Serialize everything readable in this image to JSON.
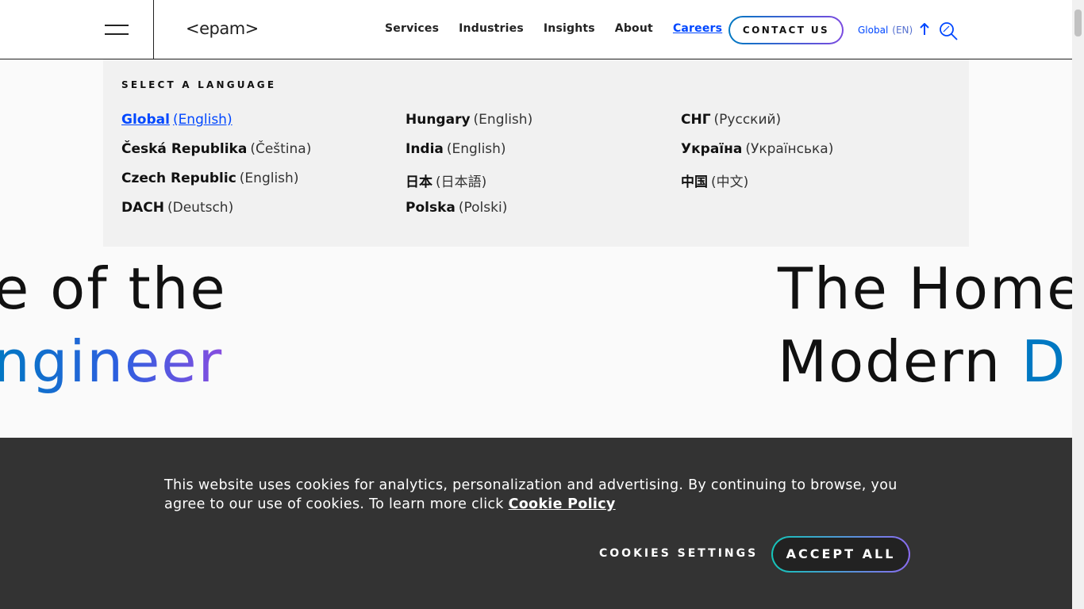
{
  "header": {
    "logo": "<epam>",
    "nav": [
      {
        "label": "Services"
      },
      {
        "label": "Industries"
      },
      {
        "label": "Insights"
      },
      {
        "label": "About"
      },
      {
        "label": "Careers"
      }
    ],
    "contact_label": "CONTACT US",
    "region": "Global",
    "region_lang": "(EN)",
    "accent": "#0047ff"
  },
  "language_panel": {
    "title": "SELECT A LANGUAGE",
    "items": [
      {
        "country": "Global",
        "language": "(English)",
        "selected": true
      },
      {
        "country": "Česká Republika",
        "language": "(Čeština)"
      },
      {
        "country": "Czech Republic",
        "language": "(English)"
      },
      {
        "country": "DACH",
        "language": "(Deutsch)"
      },
      {
        "country": "Hungary",
        "language": "(English)"
      },
      {
        "country": "India",
        "language": "(English)"
      },
      {
        "country": "日本",
        "language": "(日本語)"
      },
      {
        "country": "Polska",
        "language": "(Polski)"
      },
      {
        "country": "СНГ",
        "language": "(Русский)"
      },
      {
        "country": "Україна",
        "language": "(Українська)"
      },
      {
        "country": "中国",
        "language": "(中文)"
      }
    ]
  },
  "hero": {
    "left_line1": "e of the",
    "left_line2": "ngineer",
    "right_line1": "The Home",
    "right_line2_plain": "Modern ",
    "right_line2_accent": "D"
  },
  "cookie_banner": {
    "text": "This website uses cookies for analytics, personalization and advertising. By continuing to browse, you agree to our use of cookies. To learn more click ",
    "link": "Cookie Policy",
    "settings_label": "COOKIES SETTINGS",
    "accept_label": "ACCEPT ALL"
  }
}
